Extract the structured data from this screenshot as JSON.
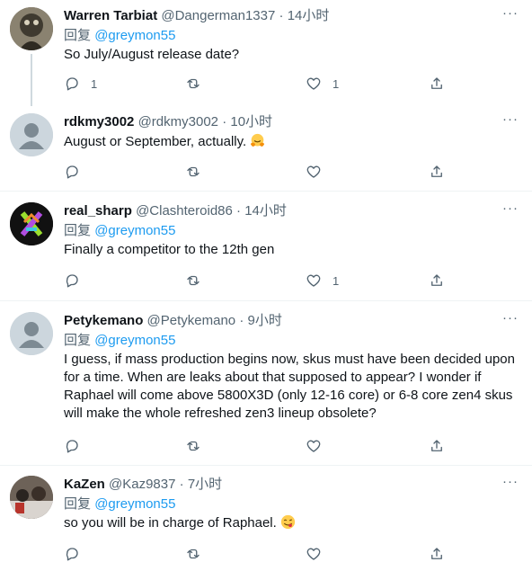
{
  "tweets": [
    {
      "name": "Warren Tarbiat",
      "handle": "@Dangerman1337",
      "dot": "·",
      "time": "14小时",
      "reply_prefix": "回复",
      "reply_to": "@greymon55",
      "text": "So July/August release date?",
      "reply_count": "1",
      "retweet_count": "",
      "like_count": "1"
    },
    {
      "name": "rdkmy3002",
      "handle": "@rdkmy3002",
      "dot": "·",
      "time": "10小时",
      "text": "August or September, actually.",
      "emoji": "hugging-face",
      "reply_count": "",
      "retweet_count": "",
      "like_count": ""
    },
    {
      "name": "real_sharp",
      "handle": "@Clashteroid86",
      "dot": "·",
      "time": "14小时",
      "reply_prefix": "回复",
      "reply_to": "@greymon55",
      "text": "Finally a competitor to the 12th gen",
      "reply_count": "",
      "retweet_count": "",
      "like_count": "1"
    },
    {
      "name": "Petykemano",
      "handle": "@Petykemano",
      "dot": "·",
      "time": "9小时",
      "reply_prefix": "回复",
      "reply_to": "@greymon55",
      "text_lines": [
        "I guess, if mass production begins now, skus must have been decided upon",
        "for a time. When are leaks about that supposed to appear? I wonder if",
        "Raphael will come above 5800X3D (only 12-16 core) or 6-8 core zen4 skus",
        "will make the whole refreshed zen3 lineup obsolete?"
      ],
      "reply_count": "",
      "retweet_count": "",
      "like_count": ""
    },
    {
      "name": "KaZen",
      "handle": "@Kaz9837",
      "dot": "·",
      "time": "7小时",
      "reply_prefix": "回复",
      "reply_to": "@greymon55",
      "text": "so you will be in charge of Raphael.",
      "emoji": "face-savoring-food",
      "reply_count": "",
      "retweet_count": "",
      "like_count": ""
    }
  ],
  "more_glyph": "···",
  "colors": {
    "link": "#1d9bf0",
    "secondary": "#536471",
    "divider": "#eff3f4",
    "thread_line": "#cfd9de"
  },
  "icons": [
    "reply-icon",
    "retweet-icon",
    "like-icon",
    "share-icon",
    "more-icon"
  ]
}
